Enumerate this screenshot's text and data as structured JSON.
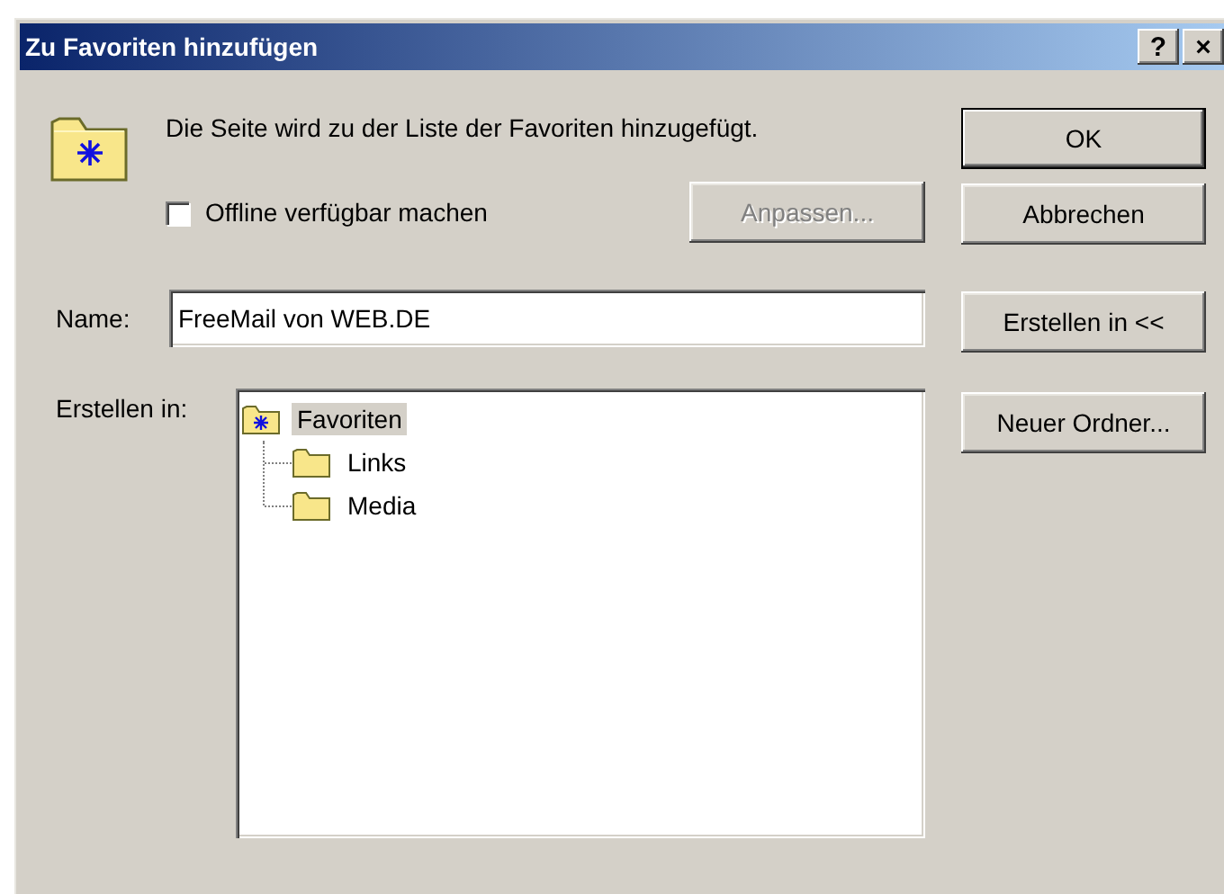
{
  "window": {
    "title": "Zu Favoriten hinzufügen",
    "title_buttons": [
      "?",
      "×"
    ]
  },
  "message": "Die Seite wird zu der Liste der Favoriten hinzugefügt.",
  "offline": {
    "label": "Offline verfügbar machen",
    "checked": false
  },
  "customize_button": {
    "label": "Anpassen...",
    "disabled": true
  },
  "name": {
    "label": "Name:",
    "value": "FreeMail von WEB.DE"
  },
  "create_in": {
    "label": "Erstellen in:",
    "tree": [
      {
        "label": "Favoriten",
        "kind": "favorites",
        "selected": true,
        "children": [
          {
            "label": "Links",
            "kind": "folder",
            "selected": false
          },
          {
            "label": "Media",
            "kind": "folder",
            "selected": false
          }
        ]
      }
    ]
  },
  "buttons": [
    {
      "label": "OK",
      "default": true
    },
    {
      "label": "Abbrechen",
      "default": false
    },
    {
      "label": "Erstellen in <<",
      "default": false
    },
    {
      "label": "Neuer Ordner...",
      "default": false
    }
  ]
}
